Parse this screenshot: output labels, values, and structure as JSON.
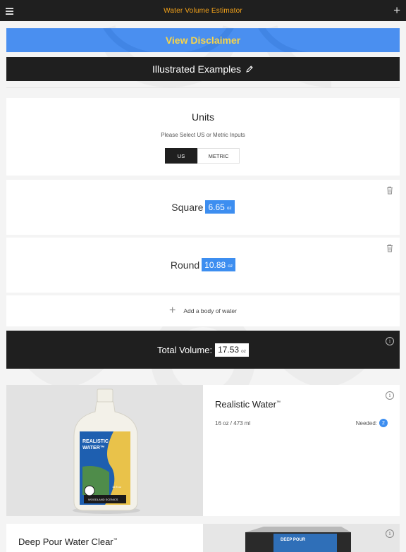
{
  "app": {
    "title": "Water Volume Estimator"
  },
  "icons": {
    "menu": "hamburger-icon",
    "add": "plus-icon",
    "edit": "pencil-icon",
    "delete": "trash-icon",
    "info": "info-icon"
  },
  "colors": {
    "accent_blue": "#3d8ef0",
    "title_orange": "#f5a31a",
    "disclaimer_text": "#f7d44a",
    "dark": "#1f1f1f"
  },
  "disclaimer": {
    "label": "View Disclaimer"
  },
  "examples": {
    "label": "Illustrated Examples"
  },
  "units": {
    "heading": "Units",
    "prompt": "Please Select US or Metric Inputs",
    "options": [
      "US",
      "METRIC"
    ],
    "selected": "US"
  },
  "bodies": [
    {
      "shape": "Square",
      "value": "6.65",
      "unit": "oz"
    },
    {
      "shape": "Round",
      "value": "10.88",
      "unit": "oz"
    }
  ],
  "add_body": {
    "label": "Add a body of water"
  },
  "total": {
    "label": "Total Volume:",
    "value": "17.53",
    "unit": "oz"
  },
  "products": [
    {
      "name": "Realistic Water",
      "tm": "™",
      "size": "16 oz / 473 ml",
      "needed_label": "Needed:",
      "needed": "2",
      "bottle_text": [
        "REALISTIC",
        "WATER™",
        "16 fl oz",
        "WOODLAND SCENICS"
      ]
    },
    {
      "name": "Deep Pour Water Clear",
      "tm": "™",
      "box_text": "DEEP POUR"
    }
  ]
}
